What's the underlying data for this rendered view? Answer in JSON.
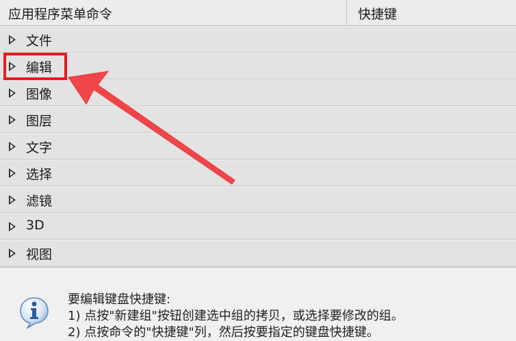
{
  "header": {
    "command_column": "应用程序菜单命令",
    "shortcut_column": "快捷键"
  },
  "menu_rows": [
    {
      "label": "文件"
    },
    {
      "label": "编辑"
    },
    {
      "label": "图像"
    },
    {
      "label": "图层"
    },
    {
      "label": "文字"
    },
    {
      "label": "选择"
    },
    {
      "label": "滤镜"
    },
    {
      "label": "3D"
    },
    {
      "label": "视图"
    }
  ],
  "info": {
    "icon": "info-icon",
    "title": "要编辑键盘快捷键:",
    "line1": "1) 点按\"新建组\"按钮创建选中组的拷贝，或选择要修改的组。",
    "line2": "2) 点按命令的\"快捷键\"列，然后按要指定的键盘快捷键。"
  },
  "colors": {
    "highlight": "#e8191e",
    "arrow": "#f0464a",
    "row_bg": "#e3e3e3"
  }
}
